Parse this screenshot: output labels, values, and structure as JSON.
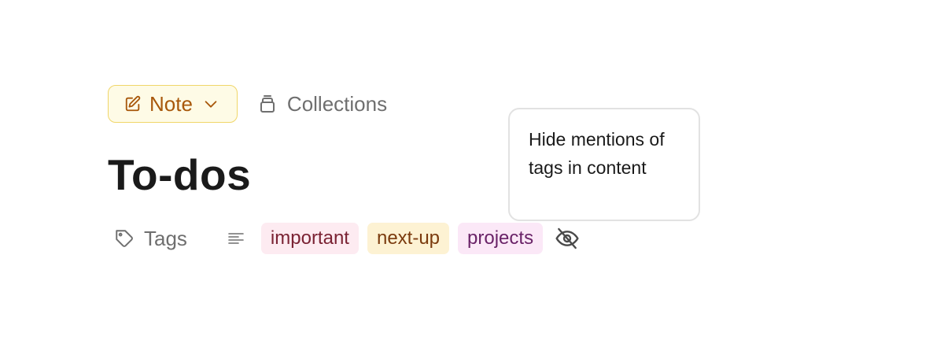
{
  "header": {
    "note_button": {
      "label": "Note",
      "icon": "edit-note-icon",
      "chevron_icon": "chevron-down-icon"
    },
    "collections_button": {
      "label": "Collections",
      "icon": "collections-icon"
    }
  },
  "title": "To-dos",
  "tags": {
    "label": "Tags",
    "label_icon": "tag-icon",
    "align_icon": "text-align-icon",
    "items": [
      {
        "label": "important",
        "bg": "#fdebf1",
        "color": "#7a2233"
      },
      {
        "label": "next-up",
        "bg": "#fdf2d3",
        "color": "#7b3b0e"
      },
      {
        "label": "projects",
        "bg": "#fbe8f7",
        "color": "#6a2368"
      }
    ],
    "visibility_icon": "eye-off-icon"
  },
  "tooltip": {
    "text": "Hide mentions of tags in content"
  },
  "colors": {
    "note_accent": "#a8580b",
    "note_bg": "#fefbe6",
    "note_border": "#f0d669",
    "muted_text": "#6f6f6f",
    "title_text": "#1a1a1a"
  }
}
